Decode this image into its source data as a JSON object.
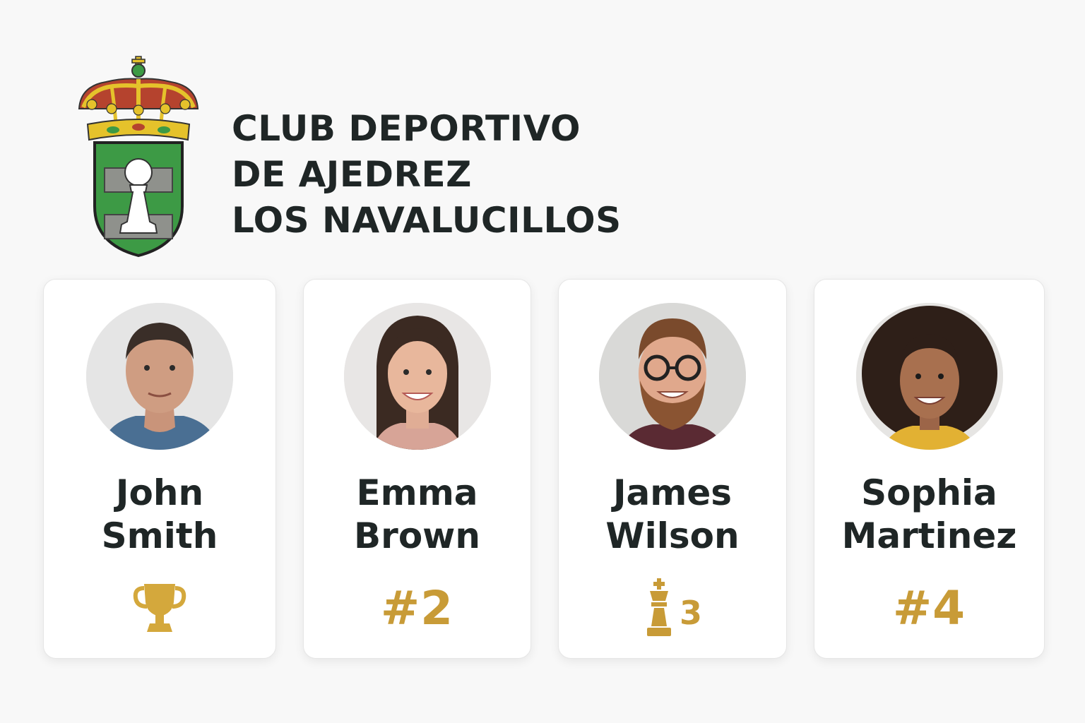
{
  "club": {
    "title_lines": [
      "CLUB DEPORTIVO",
      "DE AJEDREZ",
      "LOS NAVALUCILLOS"
    ],
    "crest_icon": "coat-of-arms-pawn-icon"
  },
  "colors": {
    "background": "#f8f8f8",
    "text": "#1f2626",
    "gold": "#c89b37",
    "crest_green": "#3d9a45",
    "crest_red": "#b5432e",
    "crest_gold": "#e5c22b"
  },
  "players": [
    {
      "first": "John",
      "last": "Smith",
      "rank_icon": "trophy-icon",
      "rank_text": ""
    },
    {
      "first": "Emma",
      "last": "Brown",
      "rank_icon": "",
      "rank_text": "#2"
    },
    {
      "first": "James",
      "last": "Wilson",
      "rank_icon": "chess-king-icon",
      "rank_text": "3"
    },
    {
      "first": "Sophia",
      "last": "Martinez",
      "rank_icon": "",
      "rank_text": "#4"
    }
  ]
}
